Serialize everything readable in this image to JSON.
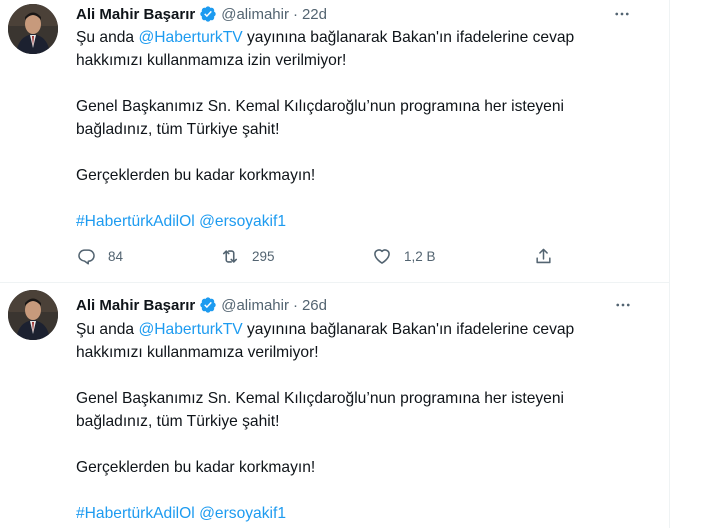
{
  "tweets": [
    {
      "author_name": "Ali Mahir Başarır",
      "author_handle": "@alimahir",
      "separator": "·",
      "time": "22d",
      "line1_prefix": "Şu anda ",
      "line1_mention": "@HaberturkTV",
      "line1_suffix": " yayınına bağlanarak Bakan'ın ifadelerine cevap",
      "line2": "hakkımızı kullanmamıza izin verilmiyor!",
      "line3": "Genel Başkanımız Sn. Kemal Kılıçdaroğlu’nun programına her isteyeni",
      "line4": "bağladınız, tüm Türkiye şahit!",
      "line5": "Gerçeklerden bu kadar korkmayın!",
      "hashtag": "#HabertürkAdilOl",
      "mention2": "@ersoyakif1",
      "reply_count": "84",
      "retweet_count": "295",
      "like_count": "1,2 B"
    },
    {
      "author_name": "Ali Mahir Başarır",
      "author_handle": "@alimahir",
      "separator": "·",
      "time": "26d",
      "line1_prefix": "Şu anda ",
      "line1_mention": "@HaberturkTV",
      "line1_suffix": " yayınına bağlanarak Bakan'ın ifadelerine cevap",
      "line2": "hakkımızı kullanmamıza verilmiyor!",
      "line3": "Genel Başkanımız Sn. Kemal Kılıçdaroğlu’nun programına her isteyeni",
      "line4": "bağladınız, tüm Türkiye şahit!",
      "line5": "Gerçeklerden bu kadar korkmayın!",
      "hashtag": "#HabertürkAdilOl",
      "mention2": "@ersoyakif1"
    }
  ],
  "icons": {
    "verified": "verified-badge-icon",
    "more": "more-icon",
    "reply": "reply-icon",
    "retweet": "retweet-icon",
    "like": "like-icon",
    "share": "share-icon"
  },
  "colors": {
    "accent": "#1d9bf0",
    "text": "#0f1419",
    "secondary": "#536471",
    "border": "#eff3f4"
  }
}
